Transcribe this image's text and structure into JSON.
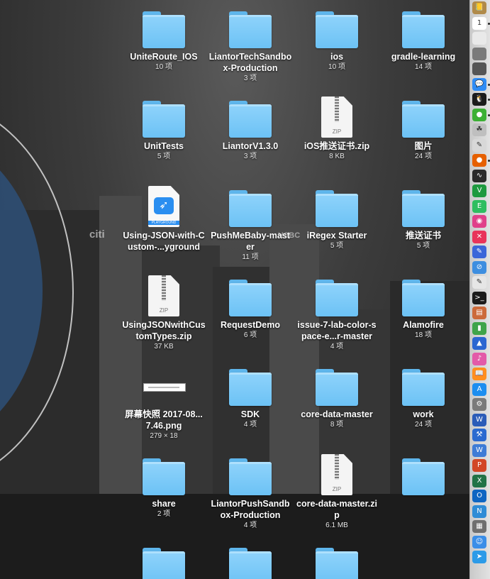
{
  "items": [
    {
      "name": "UniteRoute_IOS",
      "meta": "10 项",
      "type": "folder"
    },
    {
      "name": "LiantorTechSandbox-Production",
      "meta": "3 项",
      "type": "folder"
    },
    {
      "name": "ios",
      "meta": "10 项",
      "type": "folder"
    },
    {
      "name": "gradle-learning",
      "meta": "14 项",
      "type": "folder"
    },
    {
      "name": "UnitTests",
      "meta": "5 项",
      "type": "folder"
    },
    {
      "name": "LiantorV1.3.0",
      "meta": "3 项",
      "type": "folder"
    },
    {
      "name": "iOS推送证书.zip",
      "meta": "8 KB",
      "type": "zip"
    },
    {
      "name": "图片",
      "meta": "24 项",
      "type": "folder"
    },
    {
      "name": "Using-JSON-with-Custom-...yground",
      "meta": "",
      "type": "playground"
    },
    {
      "name": "PushMeBaby-master",
      "meta": "11 项",
      "type": "folder"
    },
    {
      "name": "iRegex Starter",
      "meta": "5 项",
      "type": "folder"
    },
    {
      "name": "推送证书",
      "meta": "5 项",
      "type": "folder"
    },
    {
      "name": "UsingJSONwithCustomTypes.zip",
      "meta": "37 KB",
      "type": "zip"
    },
    {
      "name": "RequestDemo",
      "meta": "6 项",
      "type": "folder"
    },
    {
      "name": "issue-7-lab-color-space-e...r-master",
      "meta": "4 项",
      "type": "folder"
    },
    {
      "name": "Alamofire",
      "meta": "18 项",
      "type": "folder"
    },
    {
      "name": "屏幕快照 2017-08...7.46.png",
      "meta": "279 × 18",
      "type": "image"
    },
    {
      "name": "SDK",
      "meta": "4 项",
      "type": "folder"
    },
    {
      "name": "core-data-master",
      "meta": "8 项",
      "type": "folder"
    },
    {
      "name": "work",
      "meta": "24 项",
      "type": "folder"
    },
    {
      "name": "share",
      "meta": "2 项",
      "type": "folder"
    },
    {
      "name": "LiantorPushSandbox-Production",
      "meta": "4 项",
      "type": "folder"
    },
    {
      "name": "core-data-master.zip",
      "meta": "6.1 MB",
      "type": "zip"
    },
    {
      "name": "",
      "meta": "",
      "type": "folder"
    },
    {
      "name": "",
      "meta": "",
      "type": "folder"
    },
    {
      "name": "",
      "meta": "",
      "type": "folder"
    },
    {
      "name": "",
      "meta": "",
      "type": "folder"
    }
  ],
  "wallpaper": {
    "citi": "citi",
    "hsbc": "HSBC"
  },
  "dock": [
    {
      "icon": "notes-icon",
      "glyph": "📒",
      "color": "#b08a4a",
      "dot": false
    },
    {
      "icon": "calendar-icon",
      "glyph": "1",
      "color": "#ffffff",
      "dot": true
    },
    {
      "icon": "stickies-icon",
      "glyph": "",
      "color": "#e9e9e9",
      "dot": false
    },
    {
      "icon": "books-icon",
      "glyph": "",
      "color": "#7a7a7a",
      "dot": false
    },
    {
      "icon": "activity-icon",
      "glyph": "",
      "color": "#555555",
      "dot": false
    },
    {
      "icon": "messages-icon",
      "glyph": "💬",
      "color": "#2f8cf5",
      "dot": true
    },
    {
      "icon": "qq-icon",
      "glyph": "🐧",
      "color": "#1b1b1b",
      "dot": true
    },
    {
      "icon": "wechat-icon",
      "glyph": "●",
      "color": "#3cb034",
      "dot": true
    },
    {
      "icon": "photos-icon",
      "glyph": "☘",
      "color": "#bfbfbf",
      "dot": false
    },
    {
      "icon": "texteditor-icon",
      "glyph": "✎",
      "color": "#d8d8d8",
      "dot": false
    },
    {
      "icon": "firefox-icon",
      "glyph": "●",
      "color": "#e66000",
      "dot": true
    },
    {
      "icon": "monitor-icon",
      "glyph": "∿",
      "color": "#2b2b2b",
      "dot": false
    },
    {
      "icon": "vim-icon",
      "glyph": "V",
      "color": "#1d9a3f",
      "dot": false
    },
    {
      "icon": "evernote-icon",
      "glyph": "E",
      "color": "#2dbe60",
      "dot": false
    },
    {
      "icon": "colorpicker-icon",
      "glyph": "◉",
      "color": "#e0408a",
      "dot": false
    },
    {
      "icon": "xmind-icon",
      "glyph": "✕",
      "color": "#e8335a",
      "dot": false
    },
    {
      "icon": "writing-icon",
      "glyph": "✎",
      "color": "#3a66d9",
      "dot": false
    },
    {
      "icon": "safari-icon",
      "glyph": "⊘",
      "color": "#3d8ee0",
      "dot": false
    },
    {
      "icon": "textedit-icon",
      "glyph": "✎",
      "color": "#e6e6e6",
      "dot": false
    },
    {
      "icon": "terminal-icon",
      "glyph": ">_",
      "color": "#1a1a1a",
      "dot": false
    },
    {
      "icon": "presentation-icon",
      "glyph": "▤",
      "color": "#cc6a3a",
      "dot": false
    },
    {
      "icon": "numbers-icon",
      "glyph": "▮",
      "color": "#3fa44a",
      "dot": false
    },
    {
      "icon": "keynote-icon",
      "glyph": "▲",
      "color": "#2b66d1",
      "dot": false
    },
    {
      "icon": "itunes-icon",
      "glyph": "♪",
      "color": "#e35aa8",
      "dot": false
    },
    {
      "icon": "ibooks-icon",
      "glyph": "📖",
      "color": "#ff8f1f",
      "dot": false
    },
    {
      "icon": "appstore-icon",
      "glyph": "A",
      "color": "#1c8ef0",
      "dot": false
    },
    {
      "icon": "preferences-icon",
      "glyph": "⚙",
      "color": "#7a7a7a",
      "dot": false
    },
    {
      "icon": "word-icon",
      "glyph": "W",
      "color": "#2b5cb8",
      "dot": false
    },
    {
      "icon": "xcode-icon",
      "glyph": "⚒",
      "color": "#2a6ad0",
      "dot": false
    },
    {
      "icon": "docs-icon",
      "glyph": "W",
      "color": "#3d7cd6",
      "dot": false
    },
    {
      "icon": "powerpoint-icon",
      "glyph": "P",
      "color": "#d24726",
      "dot": false
    },
    {
      "icon": "excel-icon",
      "glyph": "X",
      "color": "#217346",
      "dot": false
    },
    {
      "icon": "outlook-icon",
      "glyph": "O",
      "color": "#0e66c2",
      "dot": false
    },
    {
      "icon": "onenote-icon",
      "glyph": "N",
      "color": "#2e8cd6",
      "dot": false
    },
    {
      "icon": "archive-icon",
      "glyph": "▦",
      "color": "#6f6f6f",
      "dot": false
    },
    {
      "icon": "finder-icon",
      "glyph": "☺",
      "color": "#3a8ee8",
      "dot": false
    },
    {
      "icon": "send-icon",
      "glyph": "➤",
      "color": "#2c9be8",
      "dot": false
    }
  ]
}
